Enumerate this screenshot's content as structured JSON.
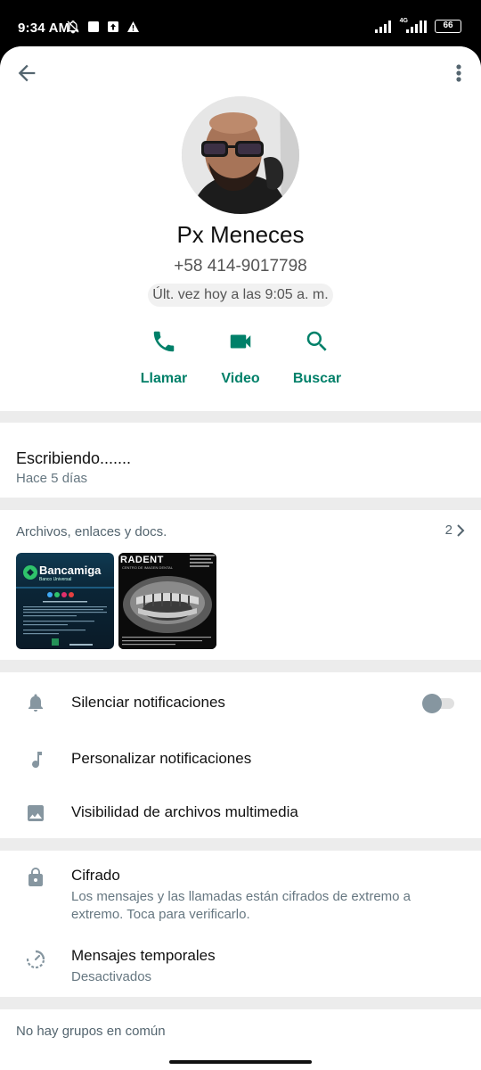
{
  "status_bar": {
    "time": "9:34 AM",
    "network": "4G",
    "battery": "66",
    "icons_left": [
      "mute-icon",
      "square-icon",
      "upload-icon",
      "warning-icon"
    ],
    "icons_right": [
      "signal-icon",
      "signal-4g-icon",
      "battery-icon"
    ]
  },
  "toolbar": {
    "back_icon": "arrow-back-icon",
    "more_icon": "more-vertical-icon"
  },
  "contact": {
    "name": "Px Meneces",
    "phone": "+58 414-9017798",
    "last_seen": "Últ. vez hoy a las 9:05 a. m."
  },
  "actions": [
    {
      "label": "Llamar",
      "icon": "phone-icon"
    },
    {
      "label": "Video",
      "icon": "video-icon"
    },
    {
      "label": "Buscar",
      "icon": "search-icon"
    }
  ],
  "about": {
    "text": "Escribiendo.......",
    "date": "Hace 5 días"
  },
  "media": {
    "title": "Archivos, enlaces y docs.",
    "count": "2",
    "thumbnails": [
      {
        "brand": "Bancamiga",
        "subtitle": "Banco Universal"
      },
      {
        "brand": "RADENT",
        "subtitle": "CENTRO DE IMAGEN DENTAL"
      }
    ]
  },
  "notifications": {
    "mute_label": "Silenciar notificaciones",
    "mute_on": false,
    "custom_label": "Personalizar notificaciones",
    "media_visibility_label": "Visibilidad de archivos multimedia"
  },
  "security": {
    "encryption_label": "Cifrado",
    "encryption_desc": "Los mensajes y las llamadas están cifrados de extremo a extremo. Toca para verificarlo.",
    "disappearing_label": "Mensajes temporales",
    "disappearing_value": "Desactivados"
  },
  "groups": {
    "title": "No hay grupos en común"
  },
  "colors": {
    "accent": "#008069",
    "icon_gray": "#8696a0",
    "secondary_text": "#667781",
    "background": "#ececec"
  }
}
